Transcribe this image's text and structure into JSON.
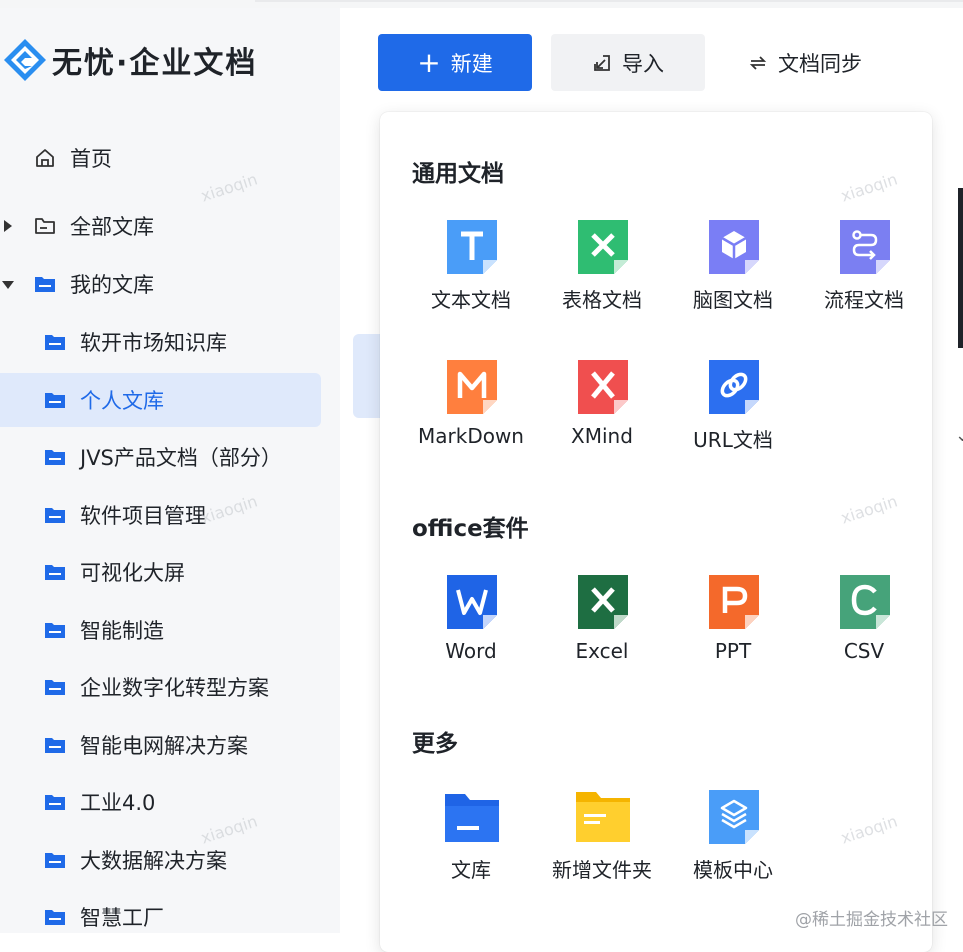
{
  "app": {
    "brand": "无忧·企业文档"
  },
  "sidebar": {
    "home": "首页",
    "all_libraries": "全部文库",
    "my_libraries": "我的文库",
    "libraries": [
      "软开市场知识库",
      "个人文库",
      "JVS产品文档（部分）",
      "软件项目管理",
      "可视化大屏",
      "智能制造",
      "企业数字化转型方案",
      "智能电网解决方案",
      "工业4.0",
      "大数据解决方案",
      "智慧工厂"
    ],
    "active_library": "个人文库"
  },
  "toolbar": {
    "new_label": "新建",
    "import_label": "导入",
    "sync_label": "文档同步"
  },
  "menu": {
    "sections": [
      {
        "title": "通用文档",
        "items": [
          "文本文档",
          "表格文档",
          "脑图文档",
          "流程文档",
          "MarkDown",
          "XMind",
          "URL文档"
        ]
      },
      {
        "title": "office套件",
        "items": [
          "Word",
          "Excel",
          "PPT",
          "CSV"
        ]
      },
      {
        "title": "更多",
        "items": [
          "文库",
          "新增文件夹",
          "模板中心"
        ]
      }
    ]
  },
  "icons": {
    "text_doc": {
      "color": "#4a9df8",
      "glyph": "T"
    },
    "sheet_doc": {
      "color": "#2fbd72",
      "glyph": "X"
    },
    "mind_doc": {
      "color": "#7a7ef5",
      "glyph": "box"
    },
    "flow_doc": {
      "color": "#7b7ff2",
      "glyph": "flow"
    },
    "markdown": {
      "color": "#ff7f3e",
      "glyph": "M"
    },
    "xmind": {
      "color": "#f04f4f",
      "glyph": "X"
    },
    "url_doc": {
      "color": "#2c6ff0",
      "glyph": "link"
    },
    "word": {
      "color": "#1f64e6",
      "glyph": "W"
    },
    "excel": {
      "color": "#1e6e42",
      "glyph": "X"
    },
    "ppt": {
      "color": "#f4692b",
      "glyph": "P"
    },
    "csv": {
      "color": "#46a37a",
      "glyph": "C"
    }
  },
  "watermark": "xiaoqin",
  "credit": "@稀土掘金技术社区"
}
